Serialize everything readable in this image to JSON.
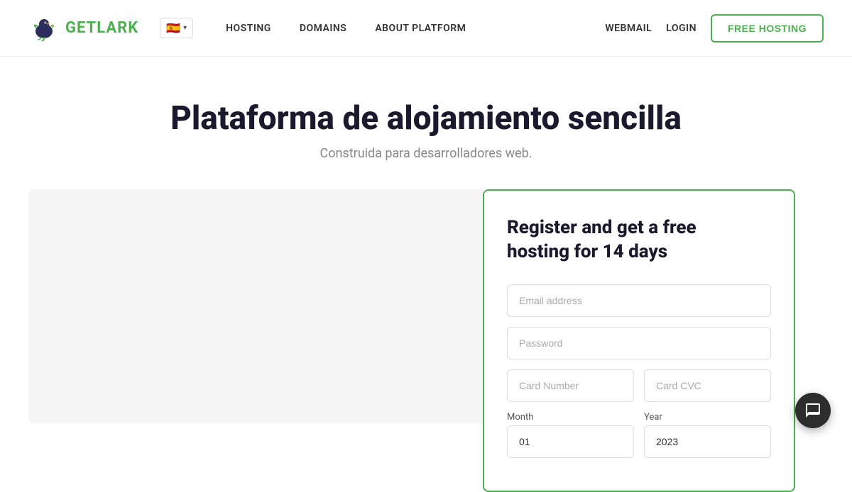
{
  "navbar": {
    "logo_get": "GET",
    "logo_lark": "LARK",
    "lang_flag": "🇪🇸",
    "lang_chevron": "▾",
    "links": [
      {
        "label": "HOSTING",
        "id": "hosting"
      },
      {
        "label": "DOMAINS",
        "id": "domains"
      },
      {
        "label": "ABOUT PLATFORM",
        "id": "about-platform"
      }
    ],
    "right_links": [
      {
        "label": "WEBMAIL",
        "id": "webmail"
      },
      {
        "label": "LOGIN",
        "id": "login"
      }
    ],
    "free_hosting_btn": "FREE HOSTING"
  },
  "hero": {
    "title": "Plataforma de alojamiento sencilla",
    "subtitle": "Construida para desarrolladores web."
  },
  "register_form": {
    "title_line1": "Register and get a free",
    "title_line2": "hosting for 14 days",
    "email_placeholder": "Email address",
    "password_placeholder": "Password",
    "card_number_placeholder": "Card Number",
    "card_cvc_placeholder": "Card CVC",
    "month_label": "Month",
    "month_value": "01",
    "year_label": "Year",
    "year_value": "2023"
  },
  "chat": {
    "icon": "💬"
  }
}
